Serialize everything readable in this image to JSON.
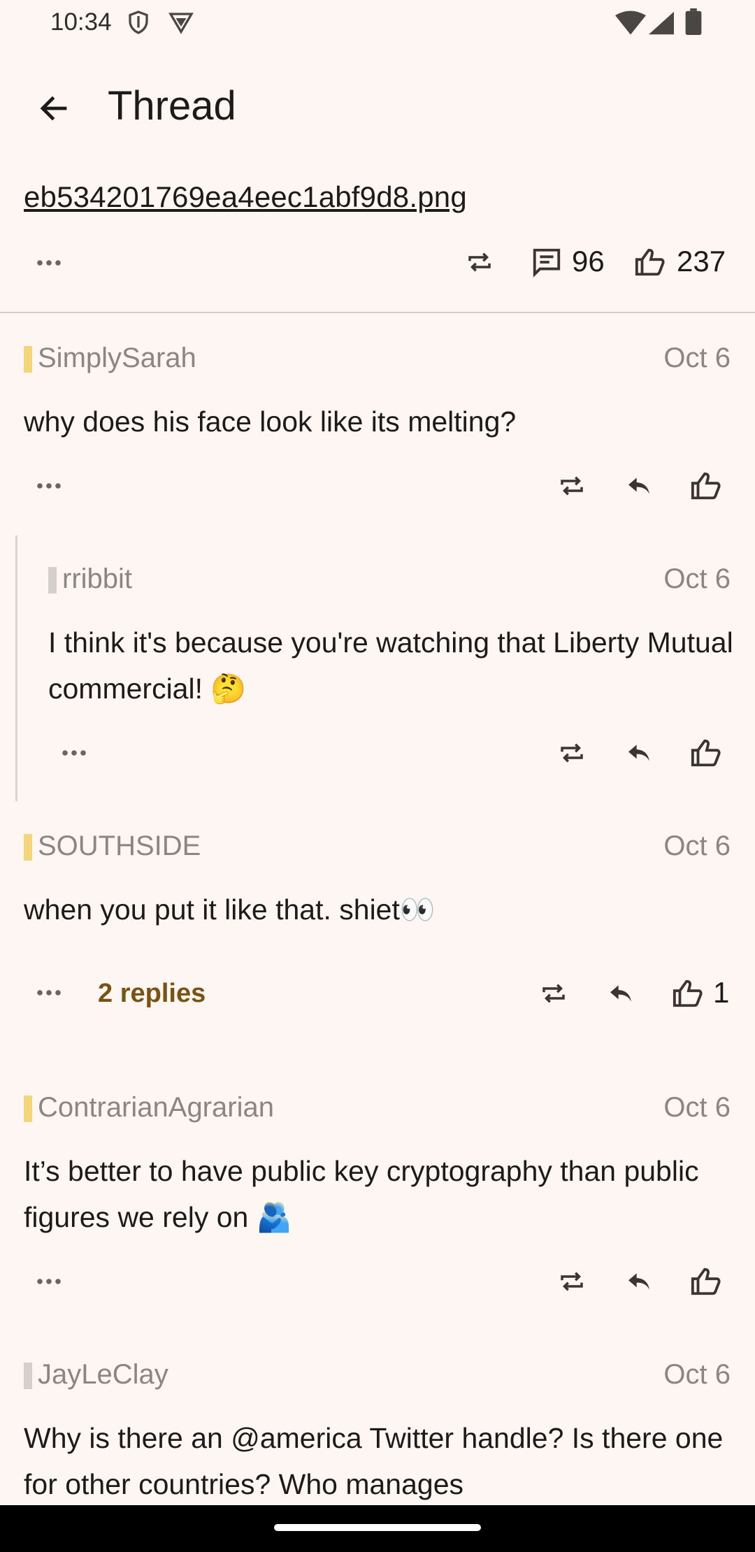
{
  "status_bar": {
    "time": "10:34",
    "icons": [
      "shield-icon",
      "vpn-triangle-icon",
      "wifi-icon",
      "cell-signal-icon",
      "battery-icon"
    ]
  },
  "top_bar": {
    "title": "Thread",
    "back_icon": "arrow-back-icon"
  },
  "post": {
    "file_name": "eb534201769ea4eec1abf9d8.png",
    "comment_count": "96",
    "like_count": "237"
  },
  "comments": [
    {
      "author": "SimplySarah",
      "author_color": "#f3d57a",
      "date": "Oct 6",
      "text": "why does his face look like its melting?"
    },
    {
      "author": "rribbit",
      "author_color": "#d6d0cc",
      "date": "Oct 6",
      "text": "I think it's because you're watching that Liberty Mutual commercial! 🤔",
      "nested": true
    },
    {
      "author": "SOUTHSIDE",
      "author_color": "#f3d57a",
      "date": "Oct 6",
      "text": "when you put it like that. shiet👀",
      "replies": "2 replies",
      "likes": "1"
    },
    {
      "author": "ContrarianAgrarian",
      "author_color": "#f3d57a",
      "date": "Oct 6",
      "text": "It’s better to have public key cryptography than public figures we rely on 🫂"
    },
    {
      "author": "JayLeClay",
      "author_color": "#d6d0cc",
      "date": "Oct 6",
      "text": "Why is there an @america Twitter handle?  Is there one for other countries?  Who manages"
    }
  ],
  "colors": {
    "background": "#fdf6f3",
    "accent_text": "#7a5212",
    "muted": "#8c8582"
  }
}
